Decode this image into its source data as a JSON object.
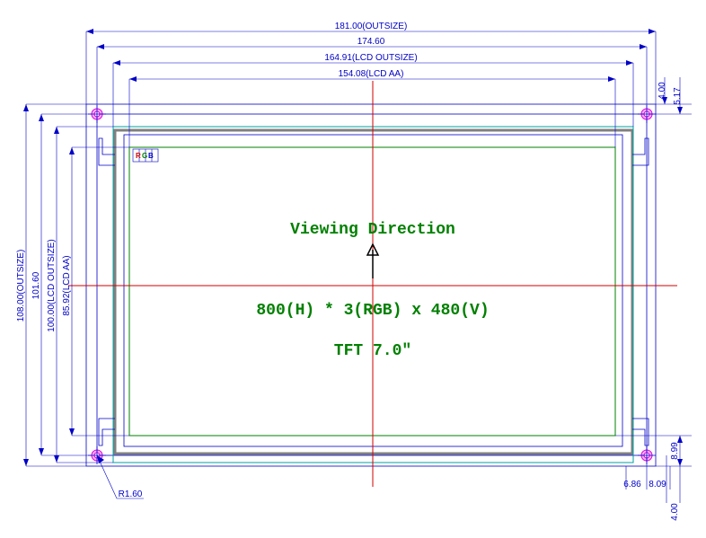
{
  "dimensions": {
    "top1": "181.00(OUTSIZE)",
    "top2": "174.60",
    "top3": "164.91(LCD OUTSIZE)",
    "top4": "154.08(LCD AA)",
    "right1": "4.00",
    "right2": "5.17",
    "right3": "8.99",
    "right4": "6.86",
    "right5": "8.09",
    "right6": "4.00",
    "left1": "108.00(OUTSIZE)",
    "left2": "101.60",
    "left3": "100.00(LCD OUTSIZE)",
    "left4": "85.92(LCD AA)",
    "radius": "R1.60"
  },
  "center": {
    "line1": "Viewing Direction",
    "line2": "800(H) * 3(RGB) x 480(V)",
    "line3": "TFT 7.0\""
  },
  "rgb_label": {
    "r": "R",
    "g": "G",
    "b": "B"
  }
}
